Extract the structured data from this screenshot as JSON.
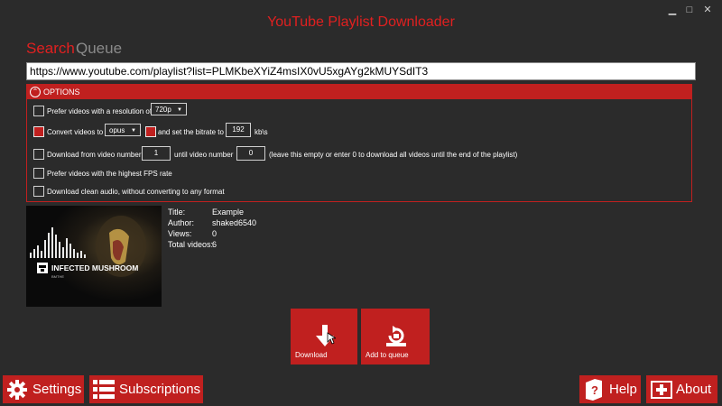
{
  "window": {
    "title": "YouTube Playlist Downloader",
    "controls": {
      "minimize": "▁",
      "maximize": "□",
      "close": "✕"
    }
  },
  "tabs": [
    {
      "label": "Search",
      "active": true
    },
    {
      "label": "Queue",
      "active": false
    }
  ],
  "url_input": {
    "value": "https://www.youtube.com/playlist?list=PLMKbeXYiZ4msIX0vU5xgAYg2kMUYSdIT3"
  },
  "options": {
    "header": "OPTIONS",
    "resolution": {
      "label": "Prefer videos with a resolution of",
      "value": "720p",
      "checked": false
    },
    "convert": {
      "label": "Convert videos to",
      "format": "opus",
      "checked": true
    },
    "bitrate": {
      "label": "and set the bitrate to",
      "value": "192",
      "unit": "kb\\s",
      "checked": true
    },
    "range": {
      "label": "Download from video number",
      "start": "1",
      "middle_label": "until video number",
      "end": "0",
      "hint": "(leave this empty or enter 0 to download all videos until the end of the playlist)",
      "checked": false
    },
    "fps": {
      "label": "Prefer videos with the highest FPS rate",
      "checked": false
    },
    "clean_audio": {
      "label": "Download clean audio, without converting to any format",
      "checked": false
    }
  },
  "thumbnail": {
    "artist": "INFECTED MUSHROOM",
    "sub": "BMTHE"
  },
  "playlist_info": {
    "title_label": "Title:",
    "title": "Example",
    "author_label": "Author:",
    "author": "shaked6540",
    "views_label": "Views:",
    "views": "0",
    "total_label": "Total videos:",
    "total": "6"
  },
  "actions": {
    "download": "Download",
    "add_to_queue": "Add to queue"
  },
  "bottom_bar": {
    "settings": "Settings",
    "subscriptions": "Subscriptions",
    "help": "Help",
    "about": "About"
  },
  "colors": {
    "accent": "#c0201f",
    "title": "#e02020",
    "background": "#2b2b2b"
  }
}
